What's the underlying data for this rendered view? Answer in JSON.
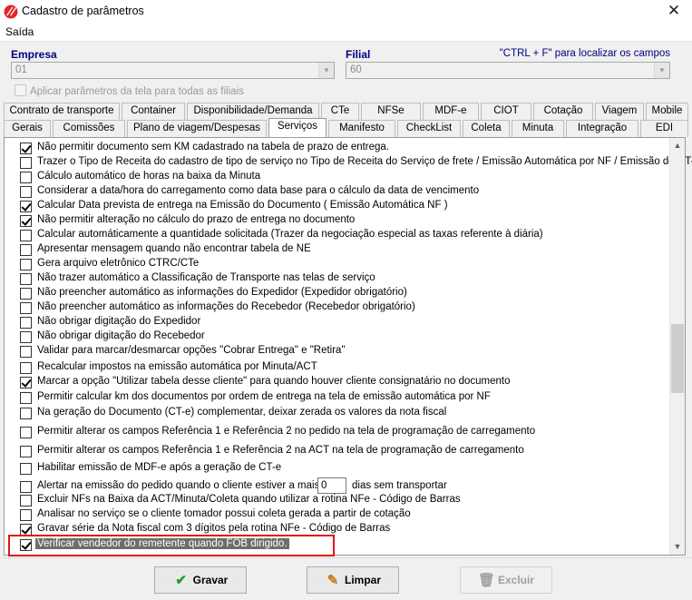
{
  "window": {
    "title": "Cadastro de parâmetros",
    "close_label": "✕"
  },
  "menu": {
    "items": [
      "Saída"
    ]
  },
  "empresa": {
    "label": "Empresa",
    "value": "01"
  },
  "filial": {
    "label": "Filial",
    "value": "60"
  },
  "hint": "\"CTRL + F\" para localizar os campos",
  "apply_all": {
    "label": "Aplicar parâmetros da tela para todas as filiais",
    "checked": false
  },
  "tabs_row1": [
    "Contrato de transporte",
    "Container",
    "Disponibilidade/Demanda",
    "CTe",
    "NFSe",
    "MDF-e",
    "CIOT",
    "Cotação",
    "Viagem",
    "Mobile"
  ],
  "tabs_row2": [
    "Gerais",
    "Comissões",
    "Plano de viagem/Despesas",
    "Serviços",
    "Manifesto",
    "CheckList",
    "Coleta",
    "Minuta",
    "Integração",
    "EDI"
  ],
  "active_tab": "Serviços",
  "options": [
    {
      "label": "Não permitir documento sem KM cadastrado na tabela de prazo de entrega.",
      "checked": true
    },
    {
      "label": "Trazer o Tipo de Receita do cadastro de tipo de serviço no Tipo de Receita do Serviço de frete / Emissão Automática por NF / Emissão de CT-e",
      "checked": false
    },
    {
      "label": "Cálculo automático de horas na baixa da Minuta",
      "checked": false
    },
    {
      "label": "Considerar a data/hora do carregamento como data base para o cálculo da data de vencimento",
      "checked": false
    },
    {
      "label": "Calcular Data prevista de entrega na Emissão do Documento ( Emissão Automática NF )",
      "checked": true
    },
    {
      "label": "Não permitir alteração no cálculo do prazo de entrega no documento",
      "checked": true
    },
    {
      "label": "Calcular automáticamente a quantidade solicitada (Trazer da negociação especial as taxas referente à diária)",
      "checked": false
    },
    {
      "label": "Apresentar mensagem quando não encontrar tabela de NE",
      "checked": false
    },
    {
      "label": "Gera arquivo eletrônico CTRC/CTe",
      "checked": false
    },
    {
      "label": "Não trazer automático a Classificação de Transporte nas telas de serviço",
      "checked": false
    },
    {
      "label": "Não preencher automático as informações do Expedidor (Expedidor obrigatório)",
      "checked": false
    },
    {
      "label": "Não preencher automático as informações do Recebedor (Recebedor obrigatório)",
      "checked": false
    },
    {
      "label": "Não obrigar digitação do Expedidor",
      "checked": false
    },
    {
      "label": "Não obrigar digitação do Recebedor",
      "checked": false
    },
    {
      "label": "Validar para marcar/desmarcar opções \"Cobrar Entrega\" e \"Retira\"",
      "checked": false
    },
    {
      "label": "Recalcular impostos na emissão automática por Minuta/ACT",
      "checked": false
    },
    {
      "label": "Marcar a opção \"Utilizar tabela desse cliente\" para quando houver cliente consignatário no documento",
      "checked": true
    },
    {
      "label": "Permitir calcular km dos documentos por ordem de entrega na tela de emissão automática por NF",
      "checked": false
    },
    {
      "label": "Na geração do Documento (CT-e) complementar, deixar zerada os valores da nota fiscal",
      "checked": false
    },
    {
      "label": "Permitir alterar os campos Referência 1 e Referência 2 no pedido na tela de programação de carregamento",
      "checked": false
    },
    {
      "label": "Permitir alterar os campos Referência 1 e Referência 2 na ACT na tela de programação de carregamento",
      "checked": false
    },
    {
      "label": "Habilitar emissão de MDF-e após a geração de CT-e",
      "checked": false
    },
    {
      "label": "Alertar na emissão do pedido quando o cliente estiver a mais de",
      "checked": false,
      "input_value": "0",
      "after": "dias sem transportar"
    },
    {
      "label": "Excluir NFs na Baixa da ACT/Minuta/Coleta quando utilizar a rotina NFe - Código de Barras",
      "checked": false
    },
    {
      "label": "Analisar no serviço se o cliente tomador possui coleta gerada a partir de cotação",
      "checked": false
    },
    {
      "label": "Gravar série da Nota fiscal com 3 dígitos pela rotina NFe - Código de Barras",
      "checked": true
    },
    {
      "label": "Verificar vendedor do remetente quando FOB dirigido.",
      "checked": true,
      "selected": true
    }
  ],
  "buttons": {
    "save": "Gravar",
    "clear": "Limpar",
    "delete": "Excluir"
  },
  "colors": {
    "label_blue": "#00007f",
    "highlight_red": "#e0141e",
    "selection_gray": "#6d6d6d"
  }
}
